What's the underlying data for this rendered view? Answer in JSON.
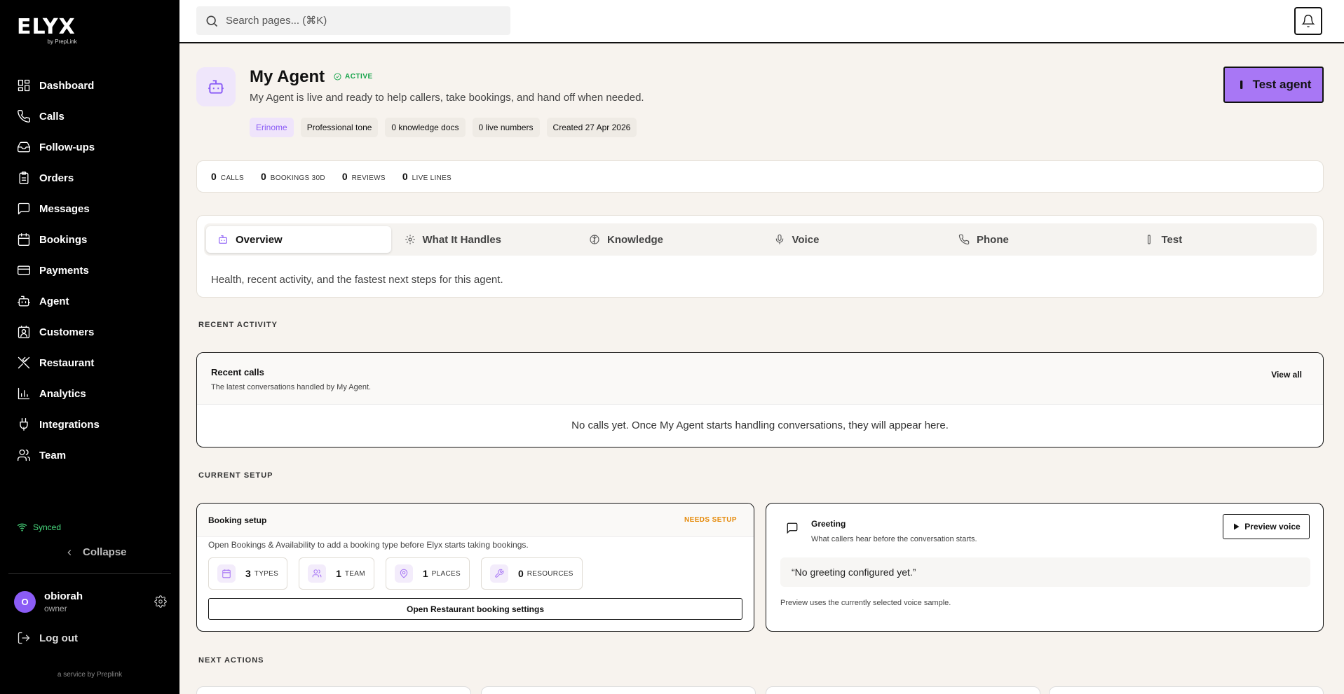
{
  "brand": {
    "name": "ELYX",
    "sub": "by PrepLink"
  },
  "sidebar": {
    "items": [
      {
        "label": "Dashboard",
        "icon": "dashboard-icon"
      },
      {
        "label": "Calls",
        "icon": "phone-icon"
      },
      {
        "label": "Follow-ups",
        "icon": "inbox-icon"
      },
      {
        "label": "Orders",
        "icon": "clipboard-icon"
      },
      {
        "label": "Messages",
        "icon": "message-icon"
      },
      {
        "label": "Bookings",
        "icon": "calendar-icon"
      },
      {
        "label": "Payments",
        "icon": "credit-card-icon"
      },
      {
        "label": "Agent",
        "icon": "bot-icon"
      },
      {
        "label": "Customers",
        "icon": "contact-icon"
      },
      {
        "label": "Restaurant",
        "icon": "utensils-icon"
      },
      {
        "label": "Analytics",
        "icon": "bar-chart-icon"
      },
      {
        "label": "Integrations",
        "icon": "plug-icon"
      },
      {
        "label": "Team",
        "icon": "users-icon"
      }
    ],
    "synced": "Synced",
    "collapse": "Collapse",
    "user": {
      "initial": "O",
      "name": "obiorah",
      "role": "owner"
    },
    "logout": "Log out",
    "service": "a service by Preplink"
  },
  "topbar": {
    "search_placeholder": "Search pages... (⌘K)"
  },
  "agent": {
    "title": "My Agent",
    "status": "ACTIVE",
    "description": "My Agent is live and ready to help callers, take bookings, and hand off when needed.",
    "chips": [
      "Erinome",
      "Professional tone",
      "0 knowledge docs",
      "0 live numbers",
      "Created 27 Apr 2026"
    ],
    "test_button": "Test agent"
  },
  "stats": [
    {
      "value": "0",
      "label": "CALLS"
    },
    {
      "value": "0",
      "label": "BOOKINGS 30D"
    },
    {
      "value": "0",
      "label": "REVIEWS"
    },
    {
      "value": "0",
      "label": "LIVE LINES"
    }
  ],
  "tabs": [
    {
      "label": "Overview",
      "icon": "bot-icon"
    },
    {
      "label": "What It Handles",
      "icon": "gear-icon"
    },
    {
      "label": "Knowledge",
      "icon": "brain-icon"
    },
    {
      "label": "Voice",
      "icon": "mic-icon"
    },
    {
      "label": "Phone",
      "icon": "phone-icon"
    },
    {
      "label": "Test",
      "icon": "test-tube-icon"
    }
  ],
  "tab_description": "Health, recent activity, and the fastest next steps for this agent.",
  "sections": {
    "recent": "RECENT ACTIVITY",
    "setup": "CURRENT SETUP",
    "next": "NEXT ACTIONS"
  },
  "recent_calls": {
    "title": "Recent calls",
    "subtitle": "The latest conversations handled by My Agent.",
    "view_all": "View all",
    "empty": "No calls yet. Once My Agent starts handling conversations, they will appear here."
  },
  "booking_setup": {
    "title": "Booking setup",
    "status": "NEEDS SETUP",
    "description": "Open Bookings & Availability to add a booking type before Elyx starts taking bookings.",
    "resources": [
      {
        "value": "3",
        "label": "TYPES",
        "icon": "calendar-icon"
      },
      {
        "value": "1",
        "label": "TEAM",
        "icon": "users-icon"
      },
      {
        "value": "1",
        "label": "PLACES",
        "icon": "map-pin-icon"
      },
      {
        "value": "0",
        "label": "RESOURCES",
        "icon": "wrench-icon"
      }
    ],
    "button": "Open Restaurant booking settings"
  },
  "greeting": {
    "title": "Greeting",
    "subtitle": "What callers hear before the conversation starts.",
    "preview_button": "Preview voice",
    "quote": "“No greeting configured yet.”",
    "note": "Preview uses the currently selected voice sample."
  }
}
